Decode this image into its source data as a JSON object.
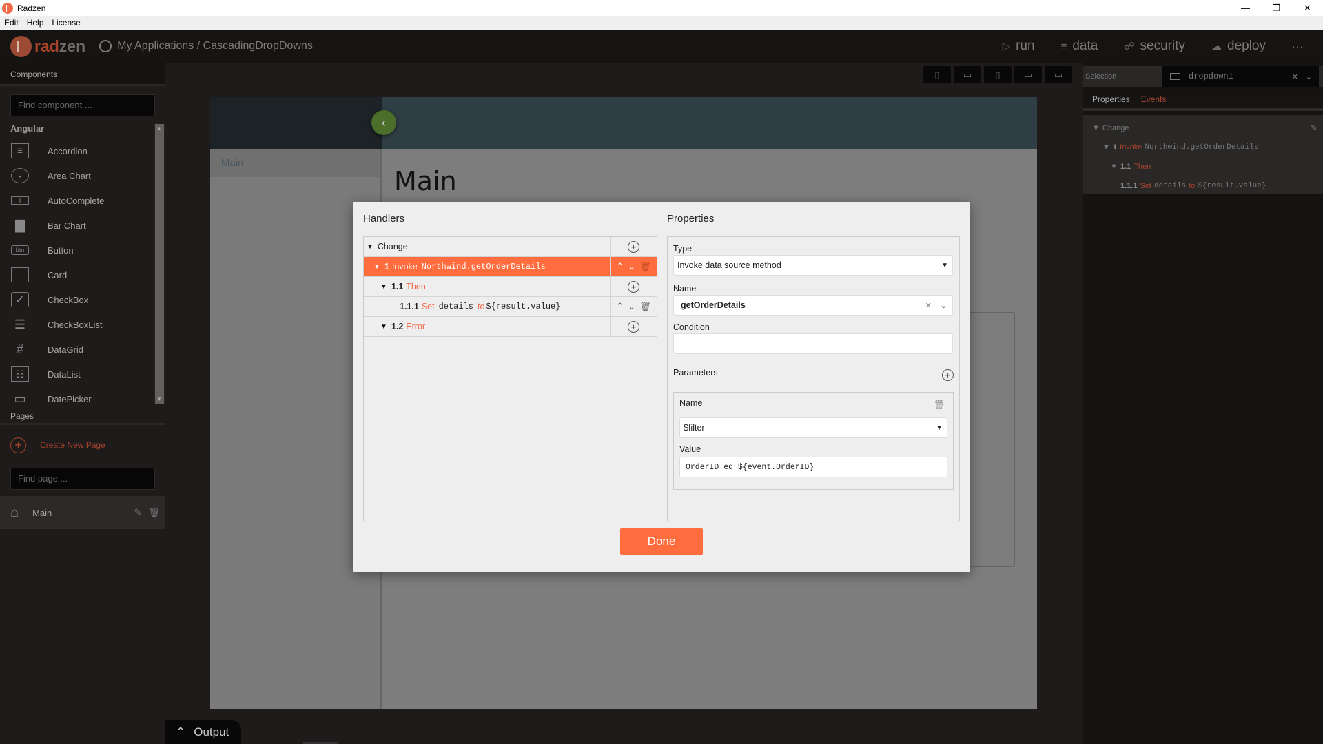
{
  "window": {
    "title": "Radzen",
    "controls": [
      "minimize",
      "restore",
      "close"
    ]
  },
  "menubar": [
    "Edit",
    "Help",
    "License"
  ],
  "header": {
    "logo_rad": "rad",
    "logo_zen": "zen",
    "breadcrumb": "My Applications / CascadingDropDowns",
    "nav": [
      {
        "label": "run",
        "icon": "play-icon"
      },
      {
        "label": "data",
        "icon": "layers-icon"
      },
      {
        "label": "security",
        "icon": "lock-icon"
      },
      {
        "label": "deploy",
        "icon": "cloud-upload-icon"
      }
    ],
    "more": "···"
  },
  "sidebar": {
    "components_title": "Components",
    "search_placeholder": "Find component ...",
    "group": "Angular",
    "components": [
      {
        "label": "Accordion",
        "icon": "accordion-icon",
        "glyph": "☰"
      },
      {
        "label": "Area Chart",
        "icon": "area-chart-icon",
        "glyph": "◒"
      },
      {
        "label": "AutoComplete",
        "icon": "autocomplete-icon",
        "glyph": "I"
      },
      {
        "label": "Bar Chart",
        "icon": "bar-chart-icon",
        "glyph": "▇"
      },
      {
        "label": "Button",
        "icon": "button-icon",
        "glyph": "btn"
      },
      {
        "label": "Card",
        "icon": "card-icon",
        "glyph": ""
      },
      {
        "label": "CheckBox",
        "icon": "checkbox-icon",
        "glyph": "✓"
      },
      {
        "label": "CheckBoxList",
        "icon": "checkboxlist-icon",
        "glyph": "☰"
      },
      {
        "label": "DataGrid",
        "icon": "datagrid-icon",
        "glyph": "#"
      },
      {
        "label": "DataList",
        "icon": "datalist-icon",
        "glyph": "☷"
      },
      {
        "label": "DatePicker",
        "icon": "datepicker-icon",
        "glyph": "▭"
      }
    ],
    "pages_title": "Pages",
    "create_page": "Create New Page",
    "page_search_placeholder": "Find page ...",
    "pages": [
      {
        "label": "Main"
      }
    ]
  },
  "canvas": {
    "side_item": "Main",
    "page_title": "Main",
    "devices": [
      "phone",
      "phone-landscape",
      "tablet",
      "laptop",
      "desktop"
    ]
  },
  "right_panel": {
    "selection_label": "Selection",
    "selected_component": "dropdown1",
    "tabs": [
      "Properties",
      "Events"
    ],
    "active_tab": "Events",
    "tree": {
      "event": "Change",
      "rows": [
        {
          "num": "1",
          "kw": "Invoke",
          "code": "Northwind.getOrderDetails"
        },
        {
          "num": "1.1",
          "kw": "Then",
          "code": ""
        },
        {
          "num": "1.1.1",
          "kw": "Set",
          "code": "details",
          "kw2": "to",
          "code2": "${result.value}"
        }
      ]
    }
  },
  "dialog": {
    "handlers_title": "Handlers",
    "properties_title": "Properties",
    "handlers": {
      "event": "Change",
      "rows": [
        {
          "num": "1",
          "kw": "Invoke",
          "code": "Northwind.getOrderDetails",
          "selected": true
        },
        {
          "num": "1.1",
          "kw": "Then",
          "code": ""
        },
        {
          "num": "1.1.1",
          "kw": "Set",
          "code": "details",
          "kw2": "to",
          "code2": "${result.value}"
        },
        {
          "num": "1.2",
          "kw": "Error",
          "code": ""
        }
      ]
    },
    "properties": {
      "type_label": "Type",
      "type_value": "Invoke data source method",
      "name_label": "Name",
      "name_value": "getOrderDetails",
      "condition_label": "Condition",
      "condition_value": "",
      "parameters_label": "Parameters",
      "param_name_label": "Name",
      "param_name_value": "$filter",
      "param_value_label": "Value",
      "param_value": "OrderID eq ${event.OrderID}"
    },
    "done_label": "Done"
  },
  "output": {
    "label": "Output"
  },
  "colors": {
    "accent": "#ff6c3e",
    "brand_dark": "#a8432c",
    "toggle_green": "#4b6e2b"
  }
}
